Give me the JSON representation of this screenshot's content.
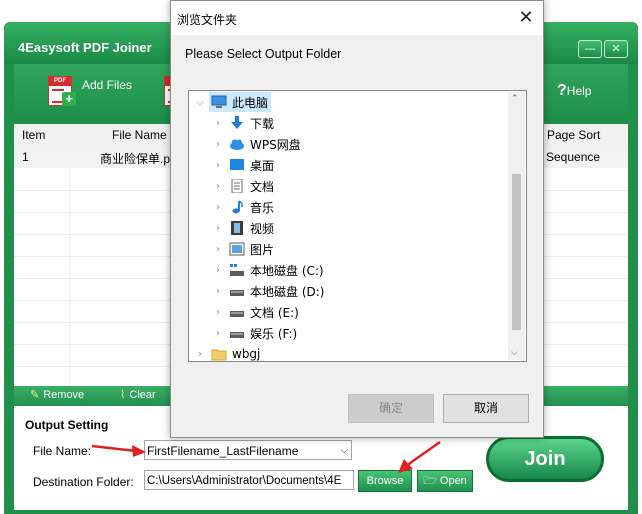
{
  "app": {
    "title": "4Easysoft PDF Joiner",
    "window_buttons": {
      "minimize": "—",
      "close": "✕"
    },
    "toolbar": {
      "add_files": "Add Files",
      "help": "Help"
    },
    "list": {
      "columns": {
        "item": "Item",
        "file_name": "File Name",
        "page_sort": "Page Sort"
      },
      "rows": [
        {
          "item": "1",
          "file_name": "商业险保单.p",
          "page_sort": "Sequence"
        }
      ]
    },
    "list_tools": {
      "remove": "Remove",
      "clear": "Clear"
    },
    "output": {
      "title": "Output Setting",
      "file_name_label": "File Name:",
      "file_name_value": "FirstFilename_LastFilename",
      "destination_label": "Destination Folder:",
      "destination_value": "C:\\Users\\Administrator\\Documents\\4E",
      "browse": "Browse",
      "open": "Open",
      "join": "Join"
    }
  },
  "dialog": {
    "title": "浏览文件夹",
    "prompt": "Please Select Output Folder",
    "tree": [
      {
        "label": "此电脑",
        "icon": "computer-icon"
      },
      {
        "label": "下载",
        "icon": "download-icon"
      },
      {
        "label": "WPS网盘",
        "icon": "cloud-icon"
      },
      {
        "label": "桌面",
        "icon": "desktop-icon"
      },
      {
        "label": "文档",
        "icon": "document-icon"
      },
      {
        "label": "音乐",
        "icon": "music-icon"
      },
      {
        "label": "视频",
        "icon": "video-icon"
      },
      {
        "label": "图片",
        "icon": "picture-icon"
      },
      {
        "label": "本地磁盘 (C:)",
        "icon": "system-drive-icon"
      },
      {
        "label": "本地磁盘 (D:)",
        "icon": "drive-icon"
      },
      {
        "label": "文档 (E:)",
        "icon": "drive-icon"
      },
      {
        "label": "娱乐 (F:)",
        "icon": "drive-icon"
      },
      {
        "label": "wbgj",
        "icon": "folder-icon"
      }
    ],
    "ok": "确定",
    "cancel": "取消"
  }
}
